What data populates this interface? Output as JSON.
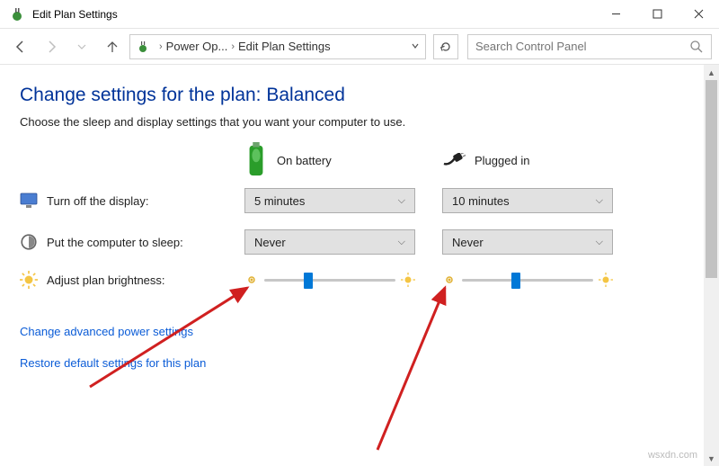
{
  "window": {
    "title": "Edit Plan Settings",
    "minimize_icon": "—",
    "maximize_icon": "▢",
    "close_icon": "✕"
  },
  "nav": {
    "breadcrumb_root": "Power Op...",
    "breadcrumb_leaf": "Edit Plan Settings",
    "search_placeholder": "Search Control Panel"
  },
  "page": {
    "title": "Change settings for the plan: Balanced",
    "subtitle": "Choose the sleep and display settings that you want your computer to use."
  },
  "columns": {
    "battery": "On battery",
    "plugged": "Plugged in"
  },
  "rows": {
    "display_label": "Turn off the display:",
    "sleep_label": "Put the computer to sleep:",
    "brightness_label": "Adjust plan brightness:"
  },
  "values": {
    "display_battery": "5 minutes",
    "display_plugged": "10 minutes",
    "sleep_battery": "Never",
    "sleep_plugged": "Never"
  },
  "sliders": {
    "battery_percent": 30,
    "plugged_percent": 38
  },
  "links": {
    "advanced": "Change advanced power settings",
    "restore": "Restore default settings for this plan"
  },
  "watermark": "wsxdn.com"
}
